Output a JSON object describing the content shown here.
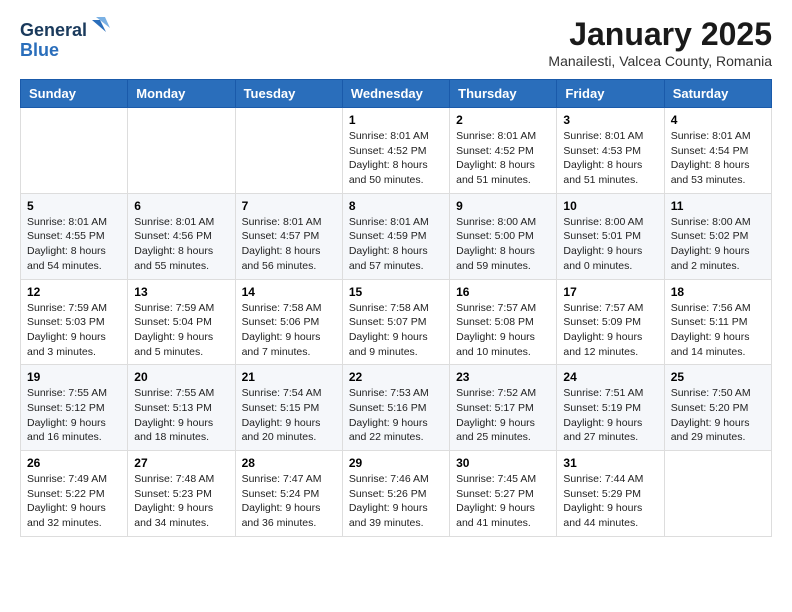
{
  "header": {
    "logo_line1": "General",
    "logo_line2": "Blue",
    "month": "January 2025",
    "location": "Manailesti, Valcea County, Romania"
  },
  "weekdays": [
    "Sunday",
    "Monday",
    "Tuesday",
    "Wednesday",
    "Thursday",
    "Friday",
    "Saturday"
  ],
  "weeks": [
    [
      {
        "day": "",
        "info": ""
      },
      {
        "day": "",
        "info": ""
      },
      {
        "day": "",
        "info": ""
      },
      {
        "day": "1",
        "info": "Sunrise: 8:01 AM\nSunset: 4:52 PM\nDaylight: 8 hours\nand 50 minutes."
      },
      {
        "day": "2",
        "info": "Sunrise: 8:01 AM\nSunset: 4:52 PM\nDaylight: 8 hours\nand 51 minutes."
      },
      {
        "day": "3",
        "info": "Sunrise: 8:01 AM\nSunset: 4:53 PM\nDaylight: 8 hours\nand 51 minutes."
      },
      {
        "day": "4",
        "info": "Sunrise: 8:01 AM\nSunset: 4:54 PM\nDaylight: 8 hours\nand 53 minutes."
      }
    ],
    [
      {
        "day": "5",
        "info": "Sunrise: 8:01 AM\nSunset: 4:55 PM\nDaylight: 8 hours\nand 54 minutes."
      },
      {
        "day": "6",
        "info": "Sunrise: 8:01 AM\nSunset: 4:56 PM\nDaylight: 8 hours\nand 55 minutes."
      },
      {
        "day": "7",
        "info": "Sunrise: 8:01 AM\nSunset: 4:57 PM\nDaylight: 8 hours\nand 56 minutes."
      },
      {
        "day": "8",
        "info": "Sunrise: 8:01 AM\nSunset: 4:59 PM\nDaylight: 8 hours\nand 57 minutes."
      },
      {
        "day": "9",
        "info": "Sunrise: 8:00 AM\nSunset: 5:00 PM\nDaylight: 8 hours\nand 59 minutes."
      },
      {
        "day": "10",
        "info": "Sunrise: 8:00 AM\nSunset: 5:01 PM\nDaylight: 9 hours\nand 0 minutes."
      },
      {
        "day": "11",
        "info": "Sunrise: 8:00 AM\nSunset: 5:02 PM\nDaylight: 9 hours\nand 2 minutes."
      }
    ],
    [
      {
        "day": "12",
        "info": "Sunrise: 7:59 AM\nSunset: 5:03 PM\nDaylight: 9 hours\nand 3 minutes."
      },
      {
        "day": "13",
        "info": "Sunrise: 7:59 AM\nSunset: 5:04 PM\nDaylight: 9 hours\nand 5 minutes."
      },
      {
        "day": "14",
        "info": "Sunrise: 7:58 AM\nSunset: 5:06 PM\nDaylight: 9 hours\nand 7 minutes."
      },
      {
        "day": "15",
        "info": "Sunrise: 7:58 AM\nSunset: 5:07 PM\nDaylight: 9 hours\nand 9 minutes."
      },
      {
        "day": "16",
        "info": "Sunrise: 7:57 AM\nSunset: 5:08 PM\nDaylight: 9 hours\nand 10 minutes."
      },
      {
        "day": "17",
        "info": "Sunrise: 7:57 AM\nSunset: 5:09 PM\nDaylight: 9 hours\nand 12 minutes."
      },
      {
        "day": "18",
        "info": "Sunrise: 7:56 AM\nSunset: 5:11 PM\nDaylight: 9 hours\nand 14 minutes."
      }
    ],
    [
      {
        "day": "19",
        "info": "Sunrise: 7:55 AM\nSunset: 5:12 PM\nDaylight: 9 hours\nand 16 minutes."
      },
      {
        "day": "20",
        "info": "Sunrise: 7:55 AM\nSunset: 5:13 PM\nDaylight: 9 hours\nand 18 minutes."
      },
      {
        "day": "21",
        "info": "Sunrise: 7:54 AM\nSunset: 5:15 PM\nDaylight: 9 hours\nand 20 minutes."
      },
      {
        "day": "22",
        "info": "Sunrise: 7:53 AM\nSunset: 5:16 PM\nDaylight: 9 hours\nand 22 minutes."
      },
      {
        "day": "23",
        "info": "Sunrise: 7:52 AM\nSunset: 5:17 PM\nDaylight: 9 hours\nand 25 minutes."
      },
      {
        "day": "24",
        "info": "Sunrise: 7:51 AM\nSunset: 5:19 PM\nDaylight: 9 hours\nand 27 minutes."
      },
      {
        "day": "25",
        "info": "Sunrise: 7:50 AM\nSunset: 5:20 PM\nDaylight: 9 hours\nand 29 minutes."
      }
    ],
    [
      {
        "day": "26",
        "info": "Sunrise: 7:49 AM\nSunset: 5:22 PM\nDaylight: 9 hours\nand 32 minutes."
      },
      {
        "day": "27",
        "info": "Sunrise: 7:48 AM\nSunset: 5:23 PM\nDaylight: 9 hours\nand 34 minutes."
      },
      {
        "day": "28",
        "info": "Sunrise: 7:47 AM\nSunset: 5:24 PM\nDaylight: 9 hours\nand 36 minutes."
      },
      {
        "day": "29",
        "info": "Sunrise: 7:46 AM\nSunset: 5:26 PM\nDaylight: 9 hours\nand 39 minutes."
      },
      {
        "day": "30",
        "info": "Sunrise: 7:45 AM\nSunset: 5:27 PM\nDaylight: 9 hours\nand 41 minutes."
      },
      {
        "day": "31",
        "info": "Sunrise: 7:44 AM\nSunset: 5:29 PM\nDaylight: 9 hours\nand 44 minutes."
      },
      {
        "day": "",
        "info": ""
      }
    ]
  ]
}
